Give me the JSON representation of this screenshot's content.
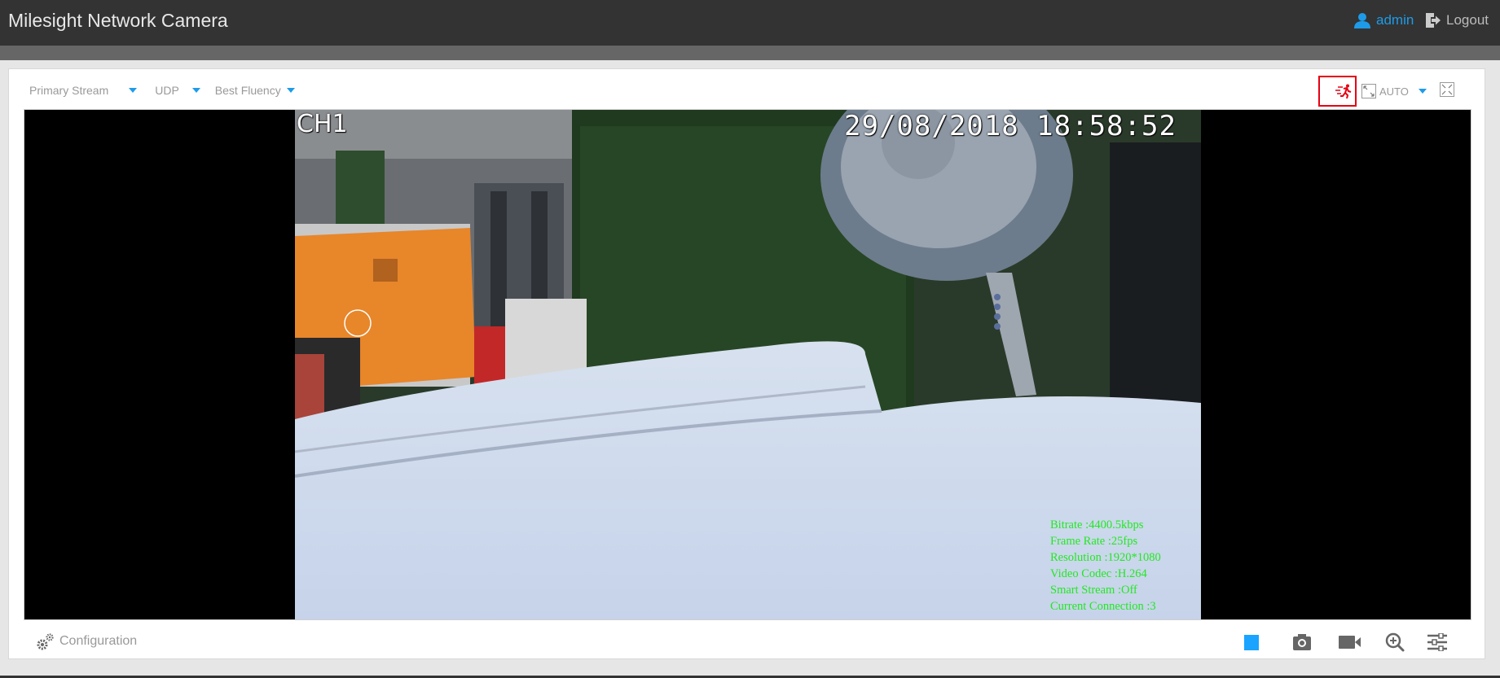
{
  "header": {
    "title": "Milesight Network Camera",
    "user_name": "admin",
    "logout_label": "Logout",
    "accent_color": "#1e9be8"
  },
  "toolbar": {
    "stream": {
      "selected": "Primary Stream"
    },
    "protocol": {
      "selected": "UDP"
    },
    "mode": {
      "selected": "Best Fluency"
    },
    "alarm_icon": "running-person-alarm-icon",
    "alarm_color": "#e60012",
    "ratio": {
      "selected": "AUTO"
    }
  },
  "video": {
    "channel": "CH1",
    "timestamp": "29/08/2018 18:58:52",
    "stats": [
      "Bitrate :4400.5kbps",
      "Frame Rate :25fps",
      "Resolution :1920*1080",
      "Video Codec :H.264",
      "Smart Stream :Off",
      "Current Connection :3"
    ],
    "stats_color": "#22e822"
  },
  "footer": {
    "config_label": "Configuration",
    "icons": [
      "stop-icon",
      "snapshot-camera-icon",
      "record-video-icon",
      "zoom-in-icon",
      "image-settings-icon"
    ]
  }
}
